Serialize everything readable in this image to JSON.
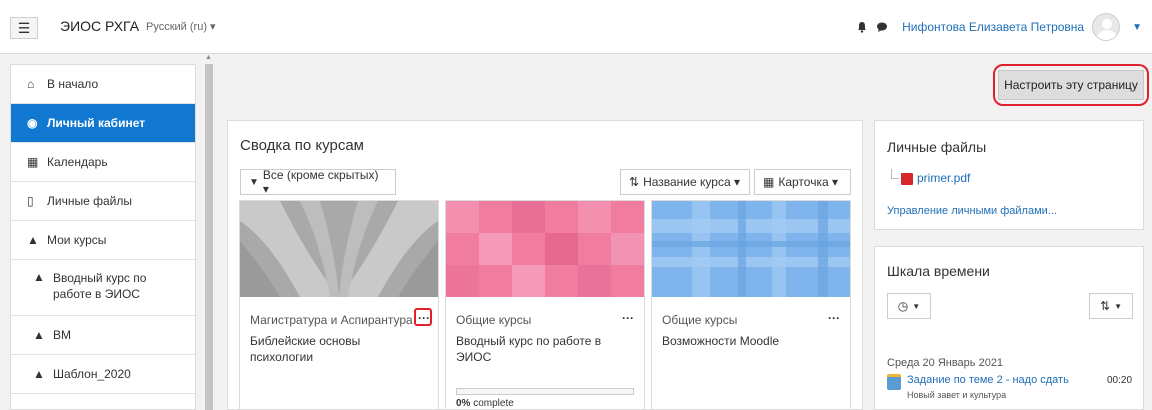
{
  "navbar": {
    "site_name": "ЭИОС РХГА",
    "language": "Русский (ru) ▾",
    "user_name": "Нифонтова Елизавета Петровна"
  },
  "sidebar": {
    "items": [
      {
        "label": "В начало",
        "icon": "home-icon"
      },
      {
        "label": "Личный кабинет",
        "icon": "dashboard-icon"
      },
      {
        "label": "Календарь",
        "icon": "calendar-icon"
      },
      {
        "label": "Личные файлы",
        "icon": "file-icon"
      },
      {
        "label": "Мои курсы",
        "icon": "graduation-cap-icon"
      },
      {
        "label": "Вводный курс по работе в ЭИОС",
        "icon": "graduation-cap-icon"
      },
      {
        "label": "ВМ",
        "icon": "graduation-cap-icon"
      },
      {
        "label": "Шаблон_2020",
        "icon": "graduation-cap-icon"
      }
    ]
  },
  "main": {
    "customize_button": "Настроить эту страницу"
  },
  "overview": {
    "title": "Сводка по курсам",
    "filter_label": "Все (кроме скрытых) ▾",
    "sort_label": "Название курса ▾",
    "view_label": "Карточка ▾",
    "courses": [
      {
        "category": "Магистратура и Аспирантура",
        "name": "Библейские основы психологии"
      },
      {
        "category": "Общие курсы",
        "name": "Вводный курс по работе в ЭИОС",
        "progress": 0,
        "progress_text_bold": "0%",
        "progress_text": " complete"
      },
      {
        "category": "Общие курсы",
        "name": "Возможности Moodle"
      }
    ]
  },
  "private_files": {
    "title": "Личные файлы",
    "file_name": "primer.pdf",
    "manage_link": "Управление личными файлами..."
  },
  "timeline": {
    "title": "Шкала времени",
    "date": "Среда 20 Январь 2021",
    "event_name": "Задание по теме 2 - надо сдать",
    "event_course": "Новый завет и культура",
    "event_time": "00:20"
  },
  "colors": {
    "accent": "#1177d1",
    "link": "#1f6fb8",
    "highlight_ring": "#e0202a"
  }
}
